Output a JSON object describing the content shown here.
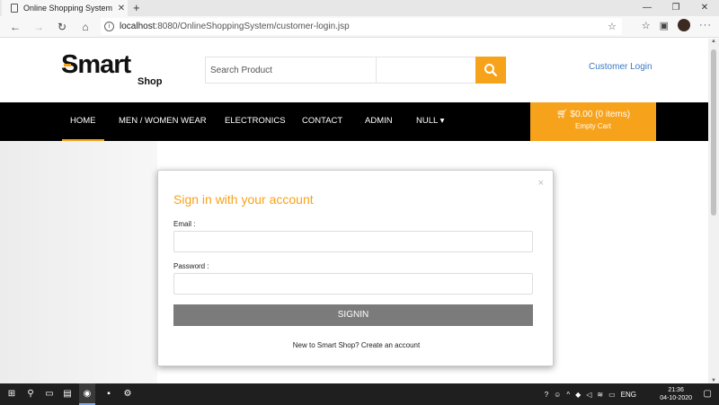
{
  "browser": {
    "tab_title": "Online Shopping System",
    "tab_close": "✕",
    "new_tab": "+",
    "url_host": "localhost",
    "url_rest": ":8080/OnlineShoppingSystem/customer-login.jsp",
    "win_min": "—",
    "win_max": "❐",
    "win_close": "✕"
  },
  "site": {
    "logo_text": "mart",
    "logo_s": "S",
    "logo_sub": "Shop",
    "search_placeholder": "Search Product",
    "customer_login": "Customer Login",
    "nav": [
      {
        "label": "HOME"
      },
      {
        "label": "MEN / WOMEN WEAR"
      },
      {
        "label": "ELECTRONICS"
      },
      {
        "label": "CONTACT"
      },
      {
        "label": "ADMIN"
      },
      {
        "label": "NULL ▾"
      }
    ],
    "cart_total": "$0.00 (0 items)",
    "cart_status": "Empty Cart"
  },
  "modal": {
    "title": "Sign in with your account",
    "close": "×",
    "email_label": "Email :",
    "password_label": "Password :",
    "signin_button": "SIGNIN",
    "footer": "New to Smart Shop? Create an account"
  },
  "taskbar": {
    "lang": "ENG",
    "time": "21:36",
    "date": "04-10-2020"
  },
  "colors": {
    "accent": "#f7a21b",
    "nav_bg": "#000000",
    "link": "#3a78c2"
  }
}
